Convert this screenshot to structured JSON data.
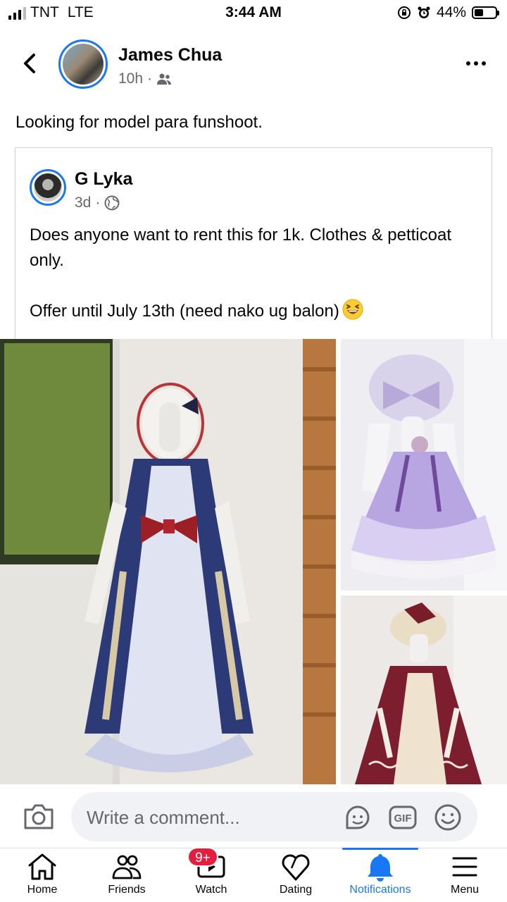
{
  "status_bar": {
    "carrier": "TNT",
    "network": "LTE",
    "time": "3:44 AM",
    "battery_percent": "44%",
    "battery_level": 0.44
  },
  "post": {
    "author": "James Chua",
    "time": "10h",
    "audience_icon": "friends-icon",
    "text": "Looking for model para funshoot."
  },
  "shared_post": {
    "author": "G Lyka",
    "time": "3d",
    "audience_icon": "globe-icon",
    "text_line1": "Does anyone want to rent this for 1k. Clothes & petticoat only.",
    "text_line2": "Offer until July 13th (need nako ug balon)",
    "emoji": "grinning-squinting-face"
  },
  "photos": [
    {
      "description_icon": "navy-lolita-dress-photo"
    },
    {
      "description_icon": "lavender-lolita-dress-photo"
    },
    {
      "description_icon": "burgundy-lolita-dress-photo"
    }
  ],
  "comment_bar": {
    "placeholder": "Write a comment..."
  },
  "nav": {
    "items": [
      {
        "label": "Home",
        "icon": "home-icon"
      },
      {
        "label": "Friends",
        "icon": "friends-icon"
      },
      {
        "label": "Watch",
        "icon": "watch-icon",
        "badge": "9+"
      },
      {
        "label": "Dating",
        "icon": "dating-icon"
      },
      {
        "label": "Notifications",
        "icon": "bell-icon",
        "active": true
      },
      {
        "label": "Menu",
        "icon": "menu-icon"
      }
    ]
  },
  "colors": {
    "accent": "#1877f2",
    "badge": "#e41e3f",
    "secondary_text": "#65676b"
  }
}
